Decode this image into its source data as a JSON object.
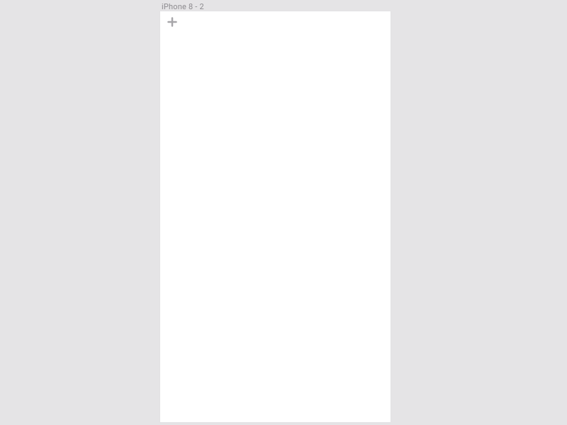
{
  "canvas": {
    "frame_label": "iPhone 8 - 2",
    "icons": {
      "add": "plus-icon"
    }
  }
}
